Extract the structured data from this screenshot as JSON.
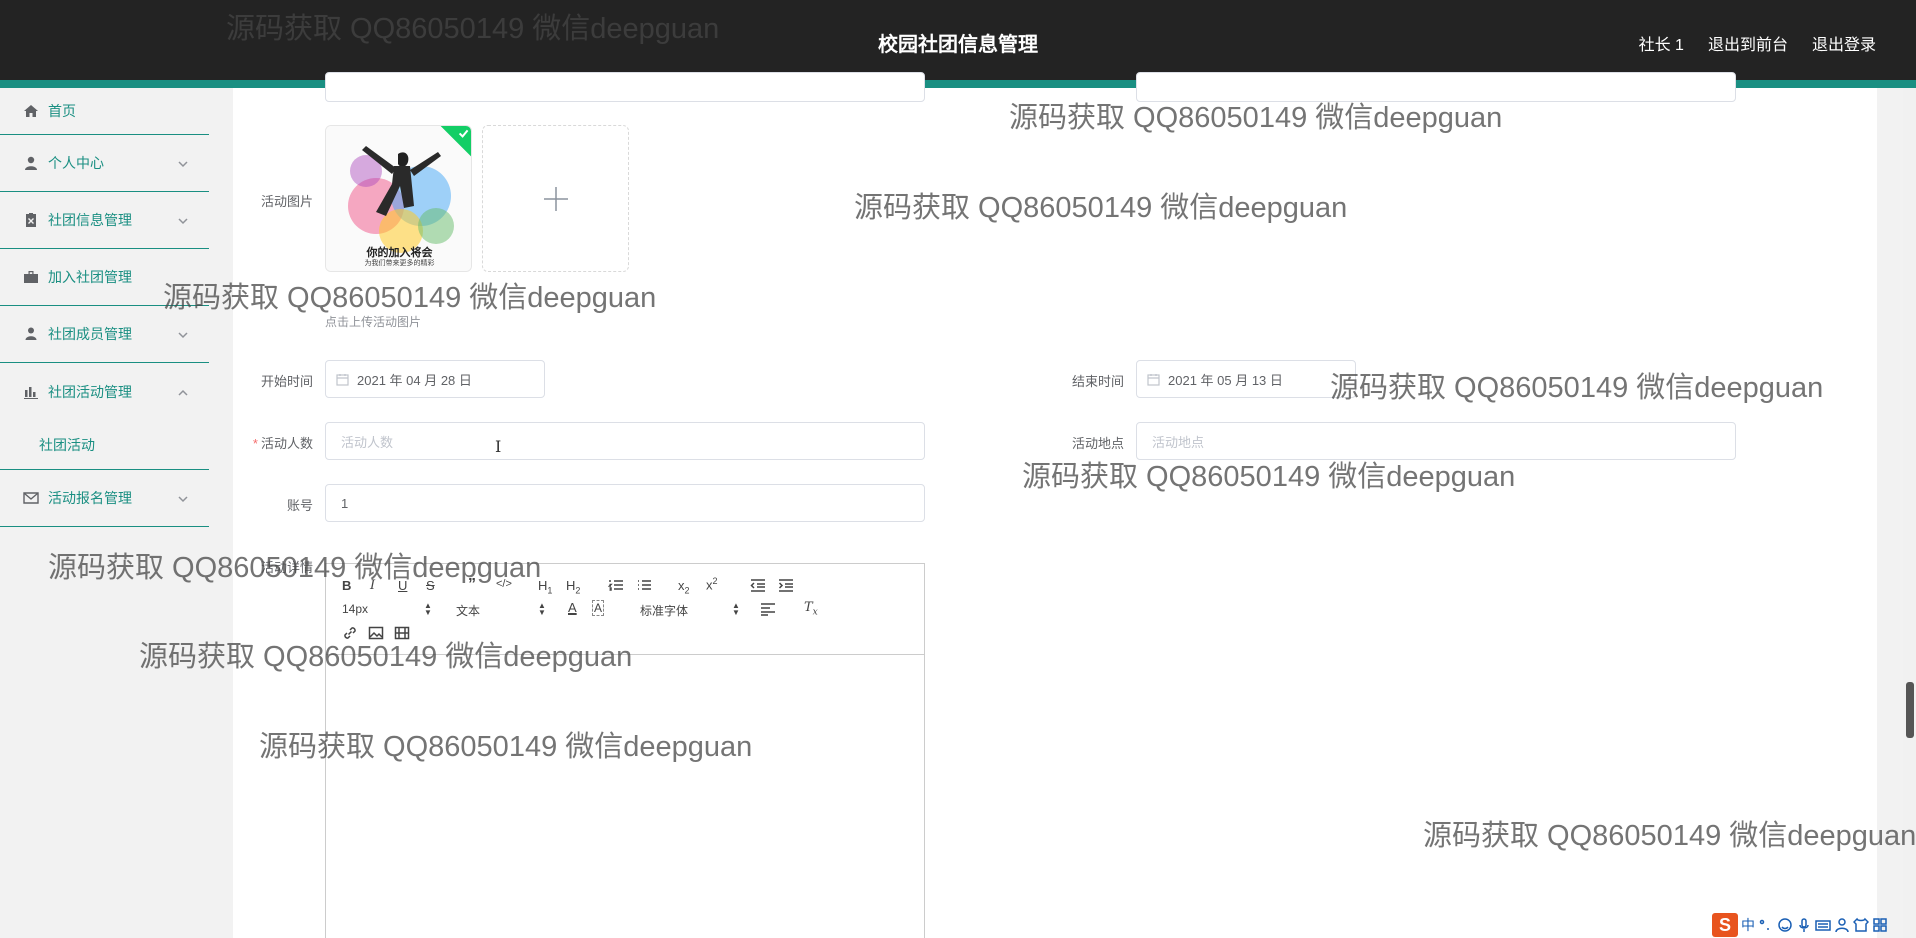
{
  "header": {
    "title": "校园社团信息管理",
    "links": [
      "社长 1",
      "退出到前台",
      "退出登录"
    ]
  },
  "sidebar": {
    "items": [
      {
        "label": "首页",
        "icon": "home-icon"
      },
      {
        "label": "个人中心",
        "icon": "user-icon"
      },
      {
        "label": "社团信息管理",
        "icon": "clipboard-icon"
      },
      {
        "label": "加入社团管理",
        "icon": "briefcase-icon"
      },
      {
        "label": "社团成员管理",
        "icon": "person-icon"
      },
      {
        "label": "社团活动管理",
        "icon": "bar-chart-icon"
      },
      {
        "label": "活动报名管理",
        "icon": "mail-icon"
      }
    ],
    "sub_item": "社团活动"
  },
  "form": {
    "image_label": "活动图片",
    "image_hint": "点击上传活动图片",
    "poster_title": "你的加入将会",
    "poster_subtitle": "为我们带来更多的精彩",
    "start_label": "开始时间",
    "start_value": "2021 年 04 月 28 日",
    "end_label": "结束时间",
    "end_value": "2021 年 05 月 13 日",
    "count_label": "活动人数",
    "count_placeholder": "活动人数",
    "location_label": "活动地点",
    "location_placeholder": "活动地点",
    "account_label": "账号",
    "account_value": "1",
    "content_label": "活动详情"
  },
  "editor": {
    "font_size": "14px",
    "heading": "文本",
    "font_family": "标准字体"
  },
  "watermark": "源码获取 QQ86050149 微信deepguan",
  "ime": {
    "lang": "中"
  },
  "colors": {
    "accent": "#1a8f82",
    "topbar": "#232323",
    "required": "#f56c6c"
  }
}
